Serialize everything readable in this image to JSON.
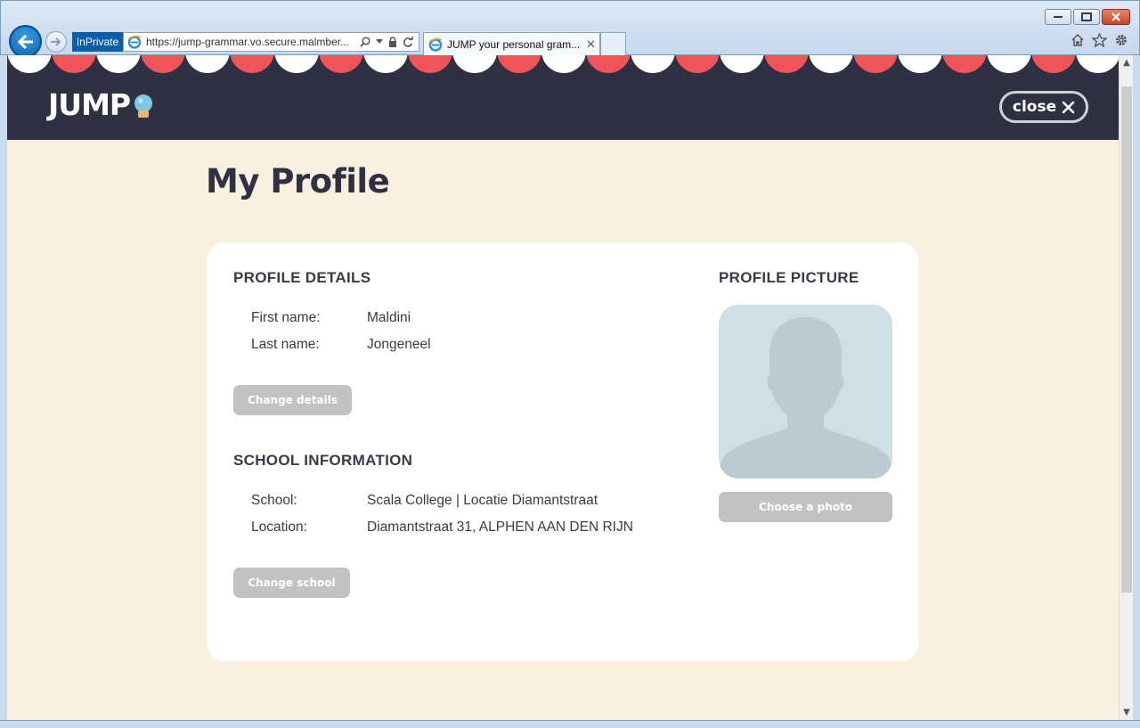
{
  "browser": {
    "inprivate_label": "InPrivate",
    "address_url": "https://jump-grammar.vo.secure.malmber...",
    "tab_title": "JUMP your personal gram...",
    "icons": [
      "back-arrow-icon",
      "forward-arrow-icon",
      "search-icon",
      "lock-icon",
      "refresh-icon",
      "home-icon",
      "favorites-star-icon",
      "settings-gear-icon"
    ]
  },
  "header": {
    "logo_text": "JUMP",
    "close_label": "close",
    "colors": {
      "header_bg": "#2f3042",
      "scallop_red": "#f0545a",
      "scallop_white": "#ffffff"
    }
  },
  "page": {
    "title": "My Profile",
    "background": "#faf0e0"
  },
  "profile_details": {
    "heading": "PROFILE DETAILS",
    "first_name_label": "First name:",
    "first_name_value": "Maldini",
    "last_name_label": "Last name:",
    "last_name_value": "Jongeneel",
    "change_button": "Change details"
  },
  "school_information": {
    "heading": "SCHOOL INFORMATION",
    "school_label": "School:",
    "school_value": "Scala College | Locatie Diamantstraat",
    "location_label": "Location:",
    "location_value": "Diamantstraat 31, ALPHEN AAN DEN RIJN",
    "change_button": "Change school"
  },
  "profile_picture": {
    "heading": "PROFILE PICTURE",
    "choose_button": "Choose a photo"
  }
}
